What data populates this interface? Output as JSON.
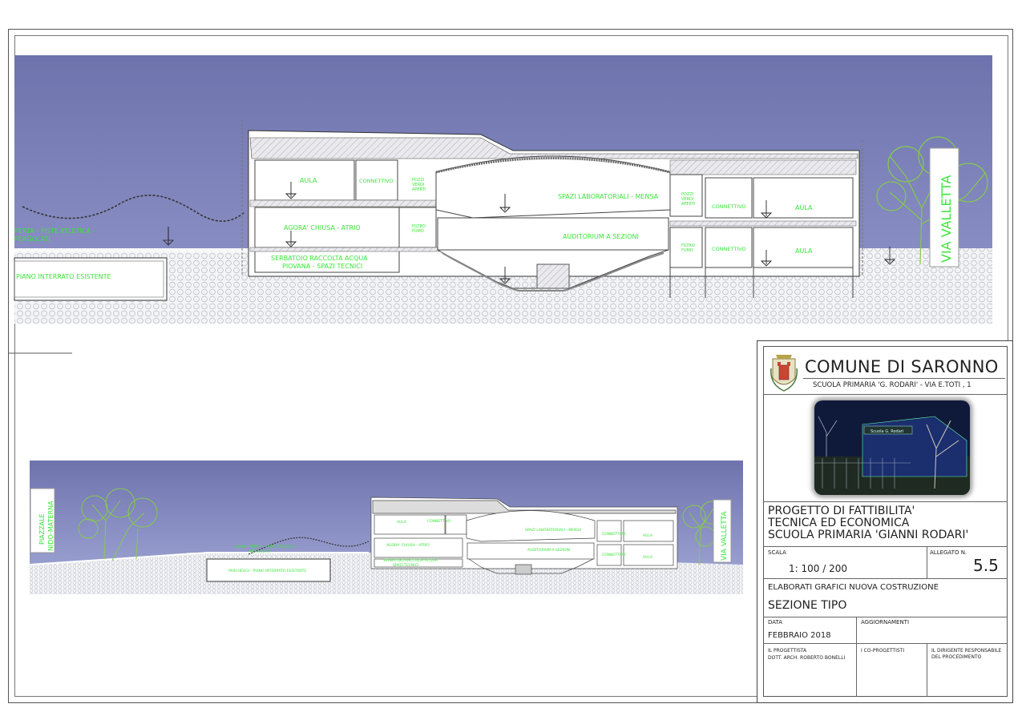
{
  "large_section": {
    "labels": {
      "aula_left": "AULA",
      "connettivo_left": "CONNETTIVO",
      "pozzi_left": "POZZI\nVERDI\nAPERTI",
      "agora": "AGORA' CHIUSA - ATRIO",
      "filtro_left": "FILTRO\nFUMO",
      "serbatoio_1": "SERBATOIO RACCOLTA ACQUA",
      "serbatoio_2": "PIOVANA - SPAZI TECNICI",
      "spazi_lab": "SPAZI LABORATORIALI - MENSA",
      "auditorium": "AUDITORIUM A SEZIONI",
      "pozzi_right": "POZZI\nVERDI\nAPERTI",
      "connettivo_right_top": "CONNETTIVO",
      "aula_right_top": "AULA",
      "filtro_right": "FILTRO\nFUMO",
      "connettivo_right_bottom": "CONNETTIVO",
      "aula_right_bottom": "AULA",
      "piste_1": "PERTA - PISTE ATLETICA -",
      "piste_2": "PERGOLATI",
      "piano_interrato": "PIANO INTERRATO ESISTENTE",
      "via": "VIA VALLETTA"
    }
  },
  "small_section": {
    "labels": {
      "piazzale": "PIAZZALE\nNIDO-MATERNA",
      "agora_aperta": "AGORA' APERTA - PISTE ATLETICA -",
      "pergolati": "PERGOLATI",
      "parcheggi": "PARCHEGGI - PIANO INTERRATO ESISTENTE",
      "aula_l": "AULA",
      "conn_l": "CONNETTIVO",
      "agora": "AGORA' CHIUSA - ATRIO",
      "serbatoio": "SERBATOIO RACCOLTA ACQUA",
      "spazi": "SPAZI TECNICI",
      "spazi_lab": "SPAZI LABORATORIALI - MENSA",
      "auditorium": "AUDITORIUM A SEZIONI",
      "conn_r1": "CONNETTIVO",
      "aula_r1": "AULA",
      "conn_r2": "CONNETTIVO",
      "aula_r2": "AULA",
      "via": "VIA VALLETTA"
    }
  },
  "title_block": {
    "comune": "COMUNE DI SARONNO",
    "scuola_indirizzo": "SCUOLA PRIMARIA 'G. RODARI' - VIA E.TOTI , 1",
    "progetto_1": "PROGETTO  DI  FATTIBILITA'",
    "progetto_2": "TECNICA  ED  ECONOMICA",
    "progetto_3": "SCUOLA  PRIMARIA  'GIANNI  RODARI'",
    "scala_label": "SCALA",
    "scala_value": "1: 100 / 200",
    "allegato_label": "ALLEGATO  N.",
    "allegato_value": "5.5",
    "elaborati": "ELABORATI  GRAFICI  NUOVA  COSTRUZIONE",
    "sezione": "SEZIONE TIPO",
    "data_label": "DATA",
    "data_value": "FEBBRAIO 2018",
    "aggiornamenti_label": "AGGIORNAMENTI",
    "progettista_label": "IL PROGETTISTA",
    "progettista_value": "DOTT. ARCH. ROBERTO  BONELLI",
    "coprogettisti_label": "I CO-PROGETTISTI",
    "dirigente_label_1": "IL DIRIGENTE RESPONSABILE",
    "dirigente_label_2": "DEL PROCEDIMENTO",
    "photo_sign": "Scuola G. Rodari"
  },
  "colors": {
    "sky": "#7b80b6",
    "label_green": "#39e639",
    "ground": "#eceff3",
    "tree": "#86c94f"
  }
}
